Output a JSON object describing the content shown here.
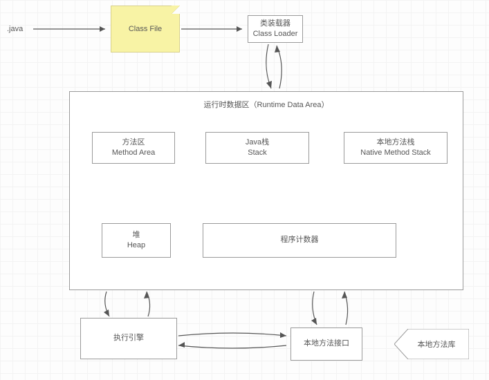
{
  "input_label": ".java",
  "class_file": "Class File",
  "class_loader": {
    "cn": "类装载器",
    "en": "Class Loader"
  },
  "runtime_area": {
    "title": "运行时数据区（Runtime Data Area）",
    "method_area": {
      "cn": "方法区",
      "en": "Method Area"
    },
    "java_stack": {
      "cn": "Java栈",
      "en": "Stack"
    },
    "native_stack": {
      "cn": "本地方法栈",
      "en": "Native Method Stack"
    },
    "heap": {
      "cn": "堆",
      "en": "Heap"
    },
    "pc_register": "程序计数器"
  },
  "exec_engine": "执行引擎",
  "native_interface": "本地方法接口",
  "native_lib": "本地方法库"
}
